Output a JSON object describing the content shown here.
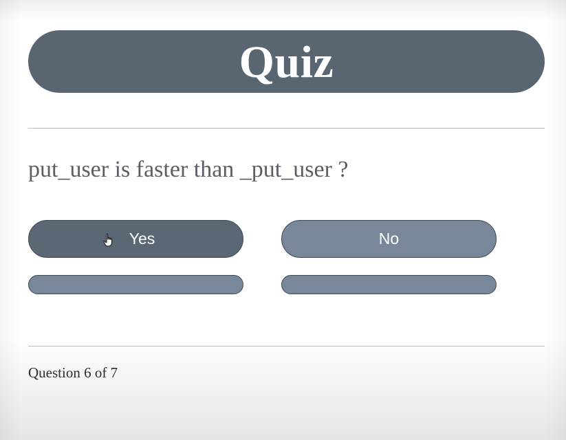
{
  "header": {
    "title": "Quiz"
  },
  "question": {
    "text": "put_user is faster than _put_user ?"
  },
  "answers": [
    {
      "label": "Yes",
      "state": "hover"
    },
    {
      "label": "No",
      "state": "default"
    }
  ],
  "footer": {
    "progress_text": "Question 6 of 7"
  },
  "icons": {
    "cursor": "hand-pointer-icon"
  },
  "colors": {
    "title_bar": "#596570",
    "button_hover": "#5b6774",
    "button_default": "#788799",
    "question_text": "#5a5f66"
  }
}
